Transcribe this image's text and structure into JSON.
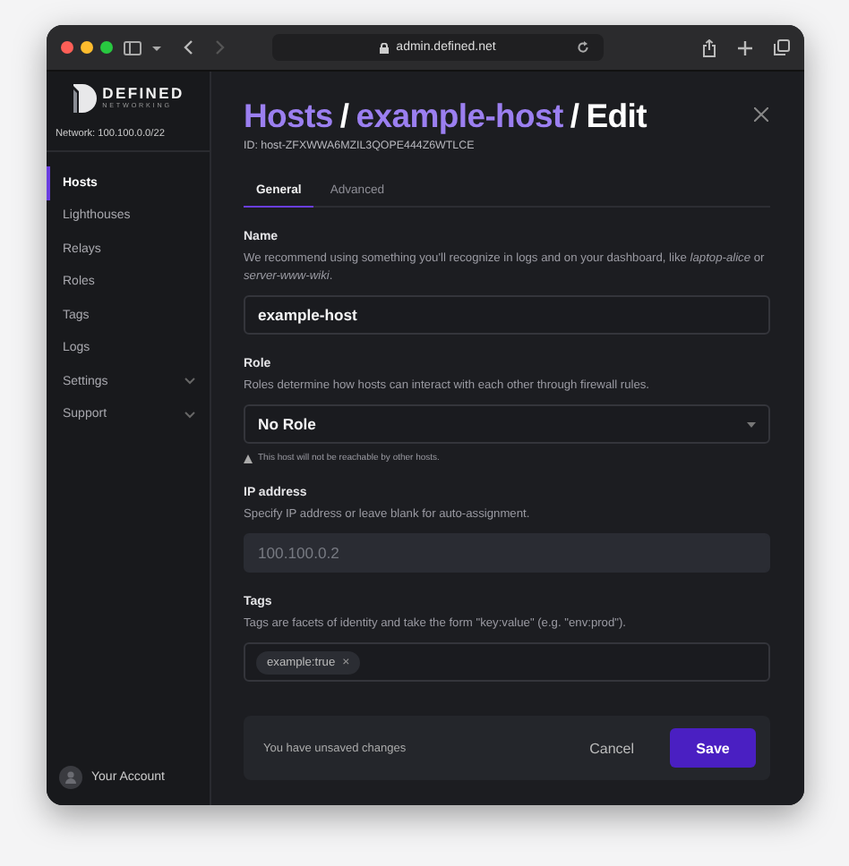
{
  "browser": {
    "url": "admin.defined.net"
  },
  "sidebar": {
    "logo": {
      "word": "DEFINED",
      "sub": "NETWORKING"
    },
    "network": "Network: 100.100.0.0/22",
    "items": [
      {
        "label": "Hosts",
        "kind": "link",
        "selected": true
      },
      {
        "label": "Lighthouses",
        "kind": "link",
        "selected": false
      },
      {
        "label": "Relays",
        "kind": "link",
        "selected": false
      },
      {
        "label": "Roles",
        "kind": "link",
        "selected": false
      },
      {
        "label": "Tags",
        "kind": "link",
        "selected": false
      },
      {
        "label": "Logs",
        "kind": "link",
        "selected": false
      },
      {
        "label": "Settings",
        "kind": "group",
        "selected": false
      },
      {
        "label": "Support",
        "kind": "group",
        "selected": false
      }
    ],
    "account": "Your Account"
  },
  "page": {
    "crumbs": [
      "Hosts",
      "example-host"
    ],
    "current": "Edit",
    "separator": "/",
    "id": "ID: host-ZFXWWA6MZIL3QOPE444Z6WTLCE",
    "tabs": [
      {
        "label": "General",
        "selected": true
      },
      {
        "label": "Advanced",
        "selected": false
      }
    ],
    "fields": [
      {
        "kind": "text",
        "label": "Name",
        "help": "We recommend using something you'll recognize in logs and on your dashboard, like *laptop-alice* or *server-www-wiki*.",
        "value": "example-host"
      },
      {
        "kind": "select",
        "label": "Role",
        "help": "Roles determine how hosts can interact with each other through firewall rules.",
        "value": "No Role",
        "warning": "This host will not be reachable by other hosts."
      },
      {
        "kind": "text",
        "label": "IP address",
        "help": "Specify IP address or leave blank for auto-assignment.",
        "placeholder": "100.100.0.2"
      },
      {
        "kind": "tags",
        "label": "Tags",
        "help": "Tags are facets of identity and take the form \"key:value\" (e.g. \"env:prod\").",
        "tags": [
          {
            "label": "example:true",
            "remove": "×"
          }
        ]
      }
    ],
    "footer": {
      "message": "You have unsaved changes",
      "cancel": "Cancel",
      "save": "Save"
    }
  }
}
